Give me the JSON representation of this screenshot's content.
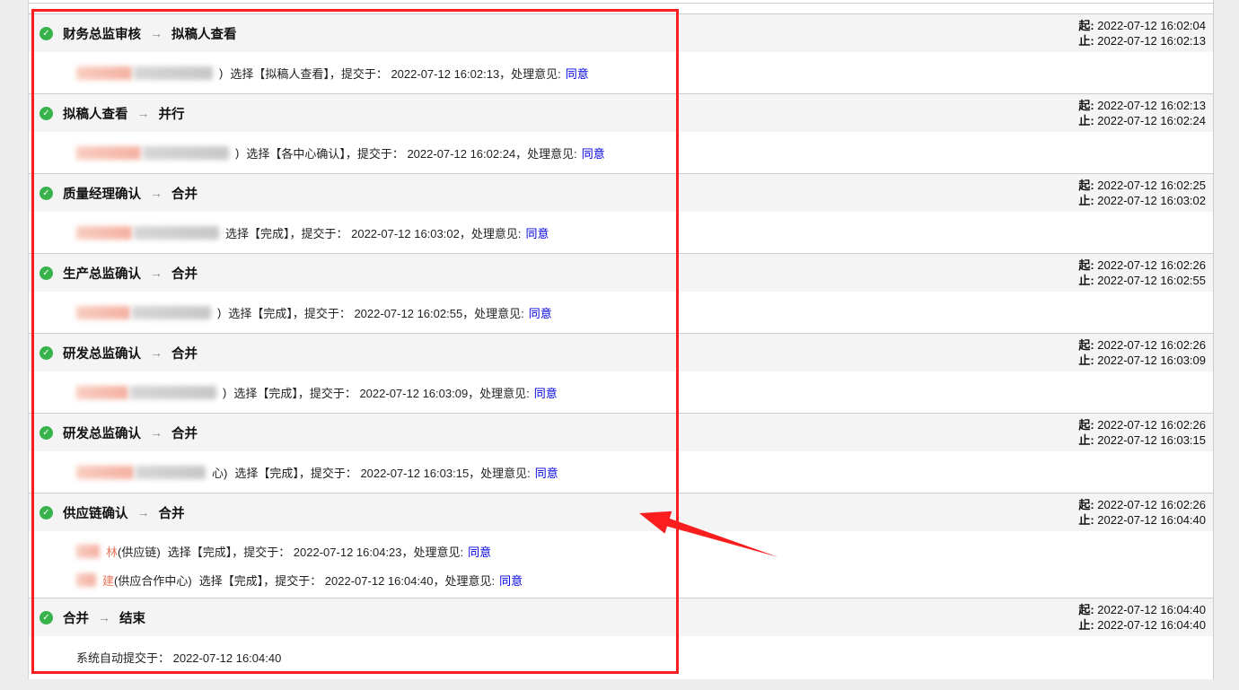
{
  "labels": {
    "start": "起:",
    "end": "止:"
  },
  "icons": {
    "check": "✓",
    "step_arrow": "→"
  },
  "colors": {
    "annotation_red": "#fa1e1e",
    "link_blue": "#0202e2",
    "check_green": "#38b24a",
    "band_gray": "#f4f4f4",
    "border_gray": "#cccccc",
    "page_gray": "#ededed",
    "name_orange": "#e8765a"
  },
  "annotation": {
    "shape": "red-rectangle-with-arrow"
  },
  "rows": [
    {
      "from": "财务总监审核",
      "to": "拟稿人查看",
      "start": "2022-07-12 16:02:04",
      "end": "2022-07-12 16:02:13",
      "details": [
        {
          "blur_a": 62,
          "blur_b": 88,
          "name_red": "",
          "name_black": ")",
          "text": "选择【拟稿人查看】，提交于： 2022-07-12 16:02:13，处理意见:",
          "link": "同意"
        }
      ]
    },
    {
      "from": "拟稿人查看",
      "to": "并行",
      "start": "2022-07-12 16:02:13",
      "end": "2022-07-12 16:02:24",
      "details": [
        {
          "blur_a": 72,
          "blur_b": 96,
          "name_red": "",
          "name_black": ")",
          "text": "选择【各中心确认】，提交于： 2022-07-12 16:02:24，处理意见:",
          "link": "同意"
        }
      ]
    },
    {
      "from": "质量经理确认",
      "to": "合并",
      "start": "2022-07-12 16:02:25",
      "end": "2022-07-12 16:03:02",
      "details": [
        {
          "blur_a": 62,
          "blur_b": 95,
          "name_red": "",
          "name_black": "",
          "text": "选择【完成】，提交于： 2022-07-12 16:03:02，处理意见:",
          "link": "同意"
        }
      ]
    },
    {
      "from": "生产总监确认",
      "to": "合并",
      "start": "2022-07-12 16:02:26",
      "end": "2022-07-12 16:02:55",
      "details": [
        {
          "blur_a": 60,
          "blur_b": 88,
          "name_red": "",
          "name_black": ")",
          "text": "选择【完成】，提交于： 2022-07-12 16:02:55，处理意见:",
          "link": "同意"
        }
      ]
    },
    {
      "from": "研发总监确认",
      "to": "合并",
      "start": "2022-07-12 16:02:26",
      "end": "2022-07-12 16:03:09",
      "details": [
        {
          "blur_a": 58,
          "blur_b": 96,
          "name_red": "",
          "name_black": ")",
          "text": "选择【完成】，提交于： 2022-07-12 16:03:09，处理意见:",
          "link": "同意"
        }
      ]
    },
    {
      "from": "研发总监确认",
      "to": "合并",
      "start": "2022-07-12 16:02:26",
      "end": "2022-07-12 16:03:15",
      "details": [
        {
          "blur_a": 64,
          "blur_b": 78,
          "name_red": "",
          "name_black": "心)",
          "text": "选择【完成】，提交于： 2022-07-12 16:03:15，处理意见:",
          "link": "同意"
        }
      ]
    },
    {
      "from": "供应链确认",
      "to": "合并",
      "start": "2022-07-12 16:02:26",
      "end": "2022-07-12 16:04:40",
      "details": [
        {
          "blur_a": 26,
          "blur_b": 0,
          "name_red": "林",
          "name_black": " (供应链)",
          "text": "选择【完成】，提交于： 2022-07-12 16:04:23，处理意见:",
          "link": "同意"
        },
        {
          "blur_a": 22,
          "blur_b": 0,
          "name_red": "建",
          "name_black": " (供应合作中心)",
          "text": "选择【完成】，提交于： 2022-07-12 16:04:40，处理意见:",
          "link": "同意"
        }
      ]
    },
    {
      "from": "合并",
      "to": "结束",
      "start": "2022-07-12 16:04:40",
      "end": "2022-07-12 16:04:40",
      "details": [
        {
          "blur_a": 0,
          "blur_b": 0,
          "name_red": "",
          "name_black": "",
          "text": "系统自动提交于： 2022-07-12 16:04:40",
          "link": null
        }
      ]
    }
  ]
}
